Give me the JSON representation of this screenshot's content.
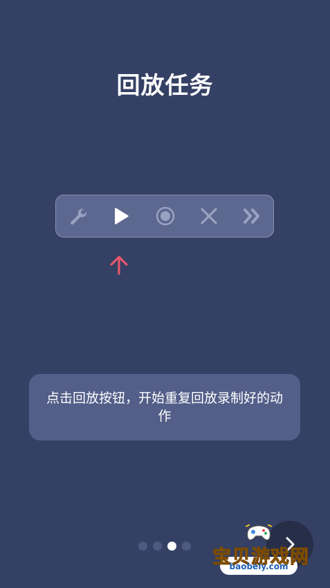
{
  "title": "回放任务",
  "toolbar": {
    "tools": [
      {
        "icon": "wrench-icon",
        "state": "inactive"
      },
      {
        "icon": "play-icon",
        "state": "active"
      },
      {
        "icon": "record-icon",
        "state": "inactive"
      },
      {
        "icon": "close-icon",
        "state": "inactive"
      },
      {
        "icon": "fast-forward-icon",
        "state": "inactive"
      }
    ]
  },
  "pointer": {
    "icon": "arrow-up-icon",
    "color": "#e8566a"
  },
  "hint": {
    "text": "点击回放按钮，开始重复回放录制好的动作"
  },
  "pagination": {
    "total": 4,
    "current": 3
  },
  "next_button": {
    "icon": "chevron-right-icon"
  },
  "watermark": {
    "text": "宝贝游戏网",
    "url": "baobeiy.com"
  },
  "colors": {
    "background": "#344064",
    "toolbar": "#5d6890",
    "hint_box": "#535f89",
    "accent_red": "#e8566a",
    "icon_inactive": "#9aa2c2",
    "icon_active": "#ffffff"
  }
}
